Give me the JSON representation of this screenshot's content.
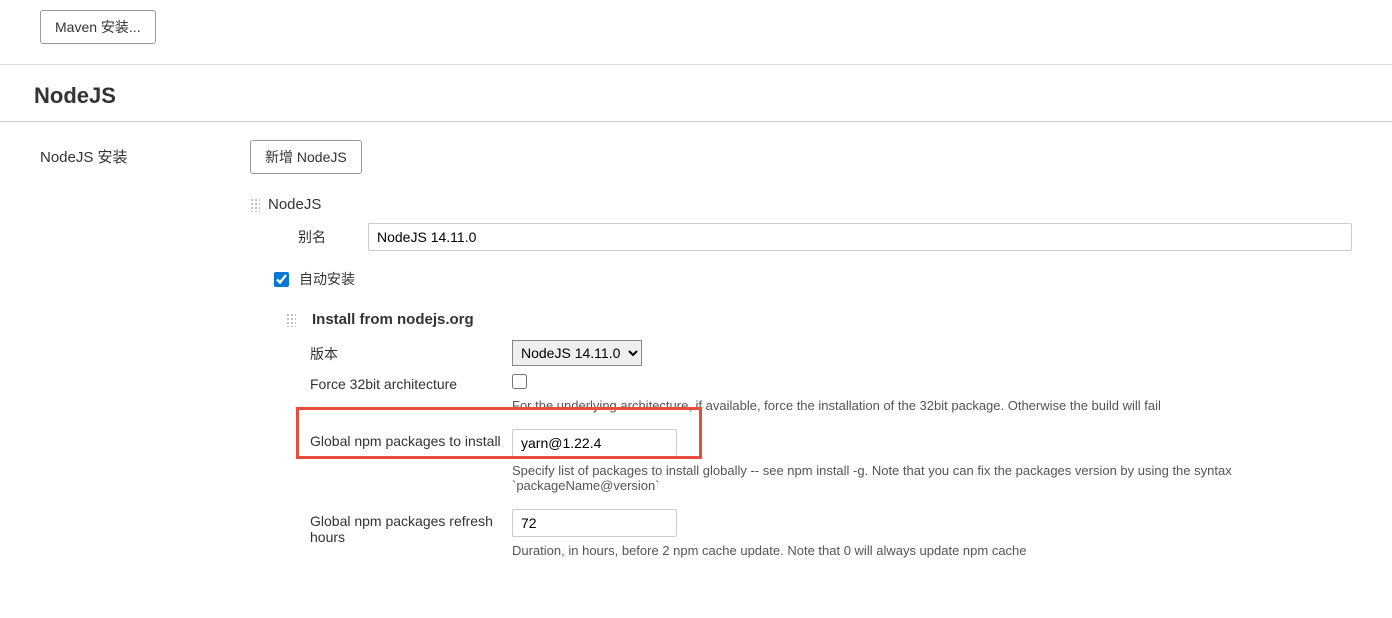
{
  "maven": {
    "install_button": "Maven 安装..."
  },
  "nodejs": {
    "section_title": "NodeJS",
    "install_label": "NodeJS 安装",
    "add_button": "新增 NodeJS",
    "tool_name": "NodeJS",
    "alias_label": "别名",
    "alias_value": "NodeJS 14.11.0",
    "auto_install_label": "自动安装",
    "auto_install_checked": true,
    "installer": {
      "title": "Install from nodejs.org",
      "version_label": "版本",
      "version_selected": "NodeJS 14.11.0",
      "force32_label": "Force 32bit architecture",
      "force32_checked": false,
      "force32_help": "For the underlying architecture, if available, force the installation of the 32bit package. Otherwise the build will fail",
      "global_packages_label": "Global npm packages to install",
      "global_packages_value": "yarn@1.22.4",
      "global_packages_help": "Specify list of packages to install globally -- see npm install -g. Note that you can fix the packages version by using the syntax `packageName@version`",
      "refresh_hours_label": "Global npm packages refresh hours",
      "refresh_hours_value": "72",
      "refresh_hours_help": "Duration, in hours, before 2 npm cache update. Note that 0 will always update npm cache"
    }
  }
}
